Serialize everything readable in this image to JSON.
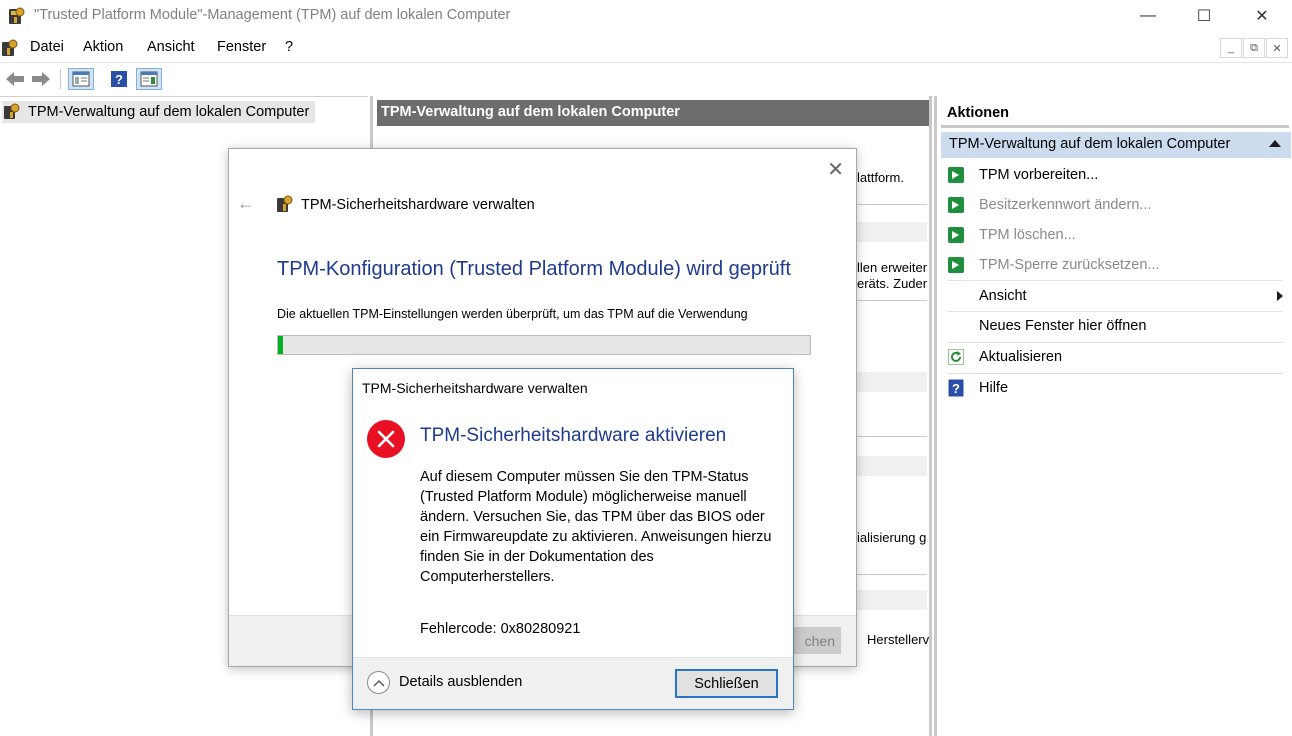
{
  "window": {
    "title": "\"Trusted Platform Module\"-Management (TPM) auf dem lokalen Computer",
    "minimize_glyph": "—",
    "maximize_glyph": "☐",
    "close_glyph": "✕"
  },
  "menubar": {
    "items": [
      "Datei",
      "Aktion",
      "Ansicht",
      "Fenster",
      "?"
    ],
    "mdi_buttons": [
      "_",
      "⧉",
      "✕"
    ]
  },
  "tree": {
    "root_label": "TPM-Verwaltung auf dem lokalen Computer"
  },
  "center": {
    "header": "TPM-Verwaltung auf dem lokalen Computer",
    "fragments": [
      "lattform.",
      "llen erweiter",
      "eräts. Zuder",
      "ialisierung g",
      "Herstellerv"
    ]
  },
  "actions": {
    "header": "Aktionen",
    "section_title": "TPM-Verwaltung auf dem lokalen Computer",
    "items": [
      {
        "label": "TPM vorbereiten...",
        "icon": "go-icon",
        "enabled": true
      },
      {
        "label": "Besitzerkennwort ändern...",
        "icon": "go-icon",
        "enabled": false
      },
      {
        "label": "TPM löschen...",
        "icon": "go-icon",
        "enabled": false
      },
      {
        "label": "TPM-Sperre zurücksetzen...",
        "icon": "go-icon",
        "enabled": false
      },
      {
        "label": "Ansicht",
        "icon": "",
        "enabled": true,
        "submenu": true
      },
      {
        "label": "Neues Fenster hier öffnen",
        "icon": "",
        "enabled": true
      },
      {
        "label": "Aktualisieren",
        "icon": "refresh-icon",
        "enabled": true
      },
      {
        "label": "Hilfe",
        "icon": "help-icon",
        "enabled": true
      }
    ]
  },
  "wizard": {
    "title": "TPM-Sicherheitshardware verwalten",
    "heading": "TPM-Konfiguration (Trusted Platform Module) wird geprüft",
    "description": "Die aktuellen TPM-Einstellungen werden überprüft, um das TPM auf die Verwendung",
    "progress_percent": 1,
    "footer_button_partial": "chen",
    "back_glyph": "←",
    "close_glyph": "✕"
  },
  "error_dialog": {
    "title": "TPM-Sicherheitshardware verwalten",
    "heading": "TPM-Sicherheitshardware aktivieren",
    "body": "Auf diesem Computer müssen Sie den TPM-Status (Trusted Platform Module) möglicherweise manuell ändern. Versuchen Sie, das TPM über das BIOS oder ein Firmwareupdate zu aktivieren. Anweisungen hierzu finden Sie in der Dokumentation des Computerherstellers.",
    "error_code": "Fehlercode: 0x80280921",
    "details_label": "Details ausblenden",
    "close_button": "Schließen"
  },
  "colors": {
    "accent_blue": "#1f3a8f",
    "section_header_bg": "#ccdcee",
    "progress_green": "#06b025",
    "error_red": "#e81123"
  }
}
